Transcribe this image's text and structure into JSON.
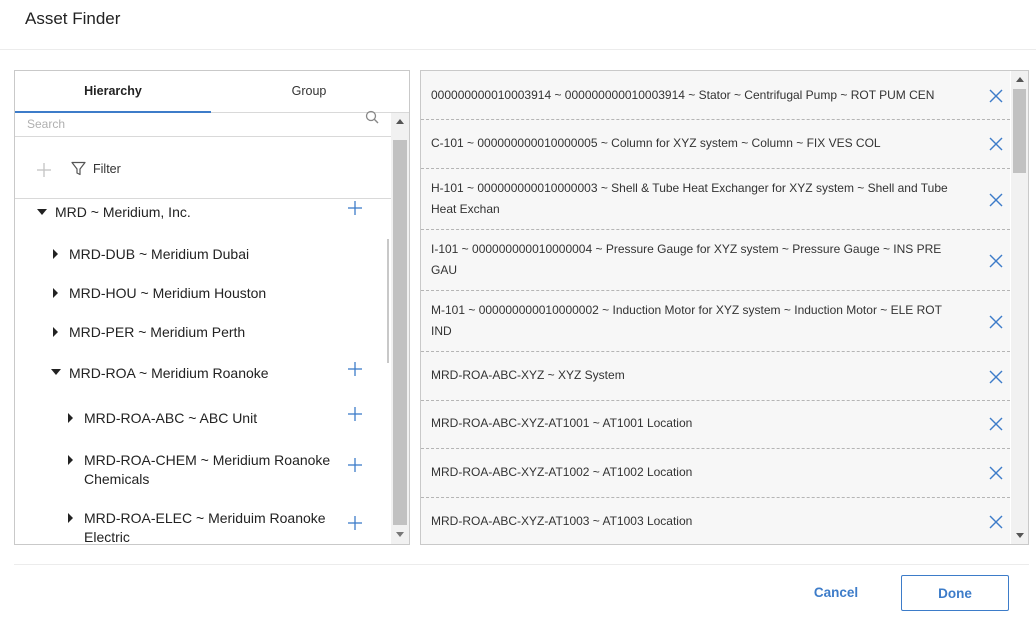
{
  "dialog": {
    "title": "Asset Finder"
  },
  "tabs": [
    {
      "label": "Hierarchy",
      "active": true
    },
    {
      "label": "Group",
      "active": false
    }
  ],
  "search": {
    "placeholder": "Search",
    "value": ""
  },
  "toolbar": {
    "filter_label": "Filter"
  },
  "tree": {
    "items": [
      {
        "label": "MRD ~ Meridium, Inc.",
        "expanded": true,
        "has_add": true
      },
      {
        "label": "MRD-DUB ~ Meridium Dubai",
        "expanded": false,
        "has_add": false
      },
      {
        "label": "MRD-HOU ~ Meridium Houston",
        "expanded": false,
        "has_add": false
      },
      {
        "label": "MRD-PER ~ Meridium Perth",
        "expanded": false,
        "has_add": false
      },
      {
        "label": "MRD-ROA ~ Meridium Roanoke",
        "expanded": true,
        "has_add": true
      },
      {
        "label": "MRD-ROA-ABC ~ ABC Unit",
        "expanded": false,
        "has_add": true
      },
      {
        "label": "MRD-ROA-CHEM ~ Meridium Roanoke Chemicals",
        "expanded": false,
        "has_add": true
      },
      {
        "label": "MRD-ROA-ELEC ~ Meriduim Roanoke Electric",
        "expanded": false,
        "has_add": true
      }
    ]
  },
  "selected": {
    "items": [
      {
        "text": "000000000010003914 ~ 000000000010003914 ~ Stator ~ Centrifugal Pump ~ ROT PUM CEN"
      },
      {
        "text": "C-101 ~ 000000000010000005 ~ Column for XYZ system ~ Column ~ FIX VES COL"
      },
      {
        "text": "H-101 ~ 000000000010000003 ~ Shell & Tube Heat Exchanger for XYZ system ~ Shell and Tube Heat Exchan"
      },
      {
        "text": "I-101 ~ 000000000010000004 ~ Pressure Gauge for XYZ system ~ Pressure Gauge ~ INS PRE GAU"
      },
      {
        "text": "M-101 ~ 000000000010000002 ~ Induction Motor for XYZ system ~ Induction Motor ~ ELE ROT IND"
      },
      {
        "text": "MRD-ROA-ABC-XYZ ~ XYZ System"
      },
      {
        "text": "MRD-ROA-ABC-XYZ-AT1001 ~ AT1001 Location"
      },
      {
        "text": "MRD-ROA-ABC-XYZ-AT1002 ~ AT1002 Location"
      },
      {
        "text": "MRD-ROA-ABC-XYZ-AT1003 ~ AT1003 Location"
      }
    ]
  },
  "footer": {
    "cancel_label": "Cancel",
    "done_label": "Done"
  },
  "colors": {
    "accent": "#3d7cc9",
    "item_bg": "#f7f7f7",
    "border": "#c9c9c9"
  }
}
